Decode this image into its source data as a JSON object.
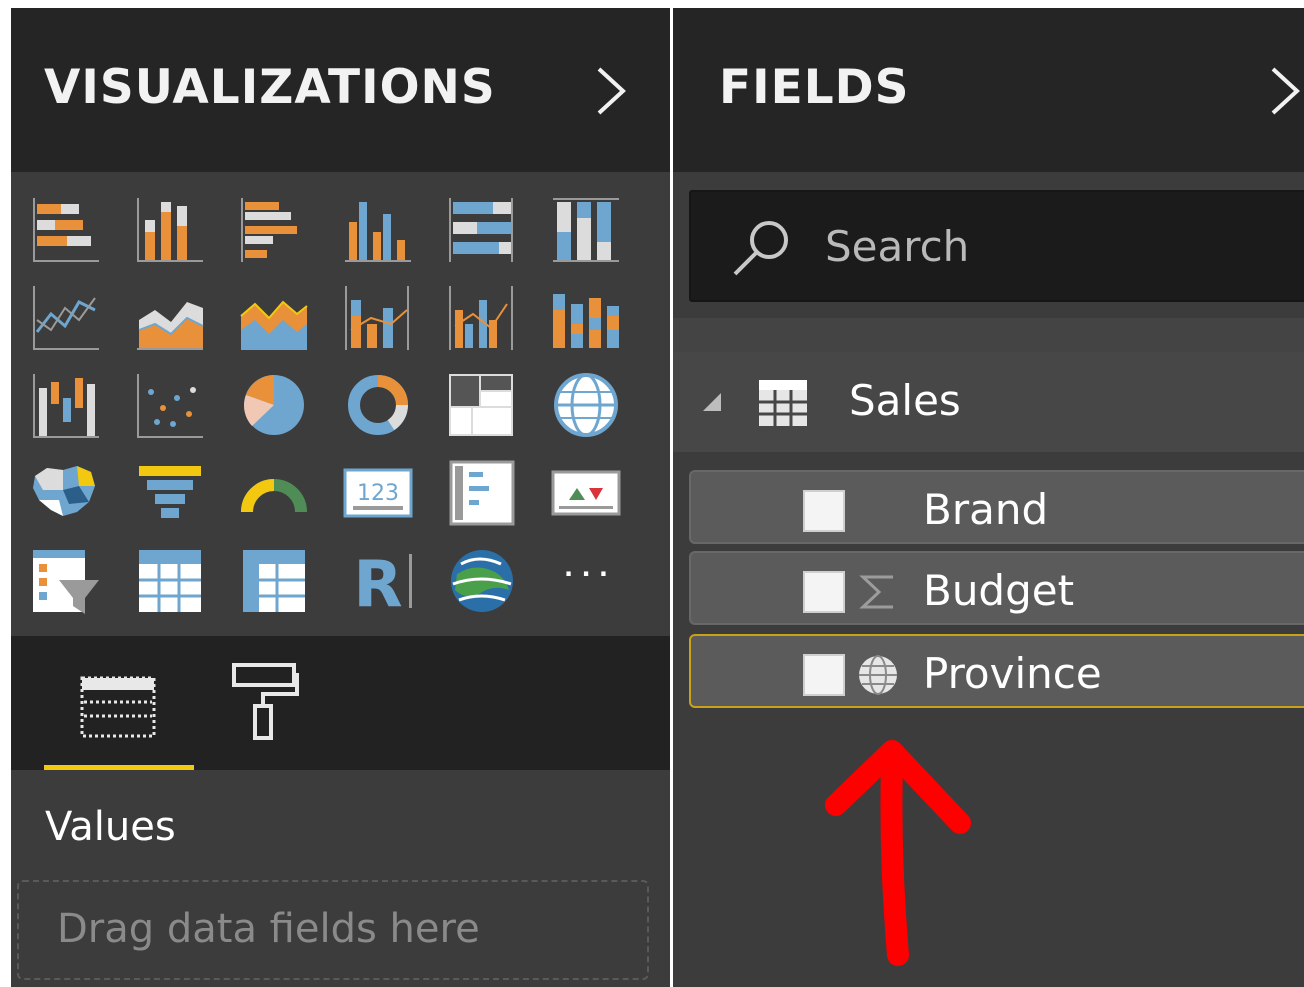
{
  "visualizations": {
    "title": "VISUALIZATIONS",
    "collapse_icon": "chevron-right-icon",
    "gallery": [
      "stacked-bar-chart-icon",
      "stacked-column-chart-icon",
      "clustered-bar-chart-icon",
      "clustered-column-chart-icon",
      "100-stacked-bar-chart-icon",
      "100-stacked-column-chart-icon",
      "line-chart-icon",
      "area-chart-icon",
      "stacked-area-chart-icon",
      "line-and-stacked-column-chart-icon",
      "line-and-clustered-column-chart-icon",
      "ribbon-chart-icon",
      "waterfall-chart-icon",
      "scatter-chart-icon",
      "pie-chart-icon",
      "donut-chart-icon",
      "treemap-icon",
      "map-icon",
      "filled-map-icon",
      "funnel-icon",
      "gauge-icon",
      "card-icon",
      "multi-row-card-icon",
      "kpi-icon",
      "slicer-icon",
      "table-icon",
      "matrix-icon",
      "r-visual-icon",
      "arcgis-map-icon",
      "more-visuals-icon"
    ],
    "more_glyph": "· · ·",
    "r_glyph": "R",
    "tabs": {
      "fields_icon": "fields-tab-icon",
      "format_icon": "paint-roller-icon",
      "active": "fields"
    },
    "values_label": "Values",
    "dropzone_placeholder": "Drag data fields here"
  },
  "fields": {
    "title": "FIELDS",
    "collapse_icon": "chevron-right-icon",
    "search_placeholder": "Search",
    "table": {
      "name": "Sales",
      "expanded": true,
      "icon": "table-grid-icon"
    },
    "items": [
      {
        "label": "Brand",
        "checked": false,
        "type_icon": "",
        "selected": false
      },
      {
        "label": "Budget",
        "checked": false,
        "type_icon": "sigma-icon",
        "selected": false
      },
      {
        "label": "Province",
        "checked": false,
        "type_icon": "globe-icon",
        "selected": true
      }
    ]
  },
  "colors": {
    "accent_yellow": "#f2c811",
    "chart_orange": "#e8913a",
    "chart_blue": "#6ea6cf",
    "annotation_red": "#ff0000",
    "pane_dark": "#252525",
    "pane_body": "#3c3c3c"
  }
}
